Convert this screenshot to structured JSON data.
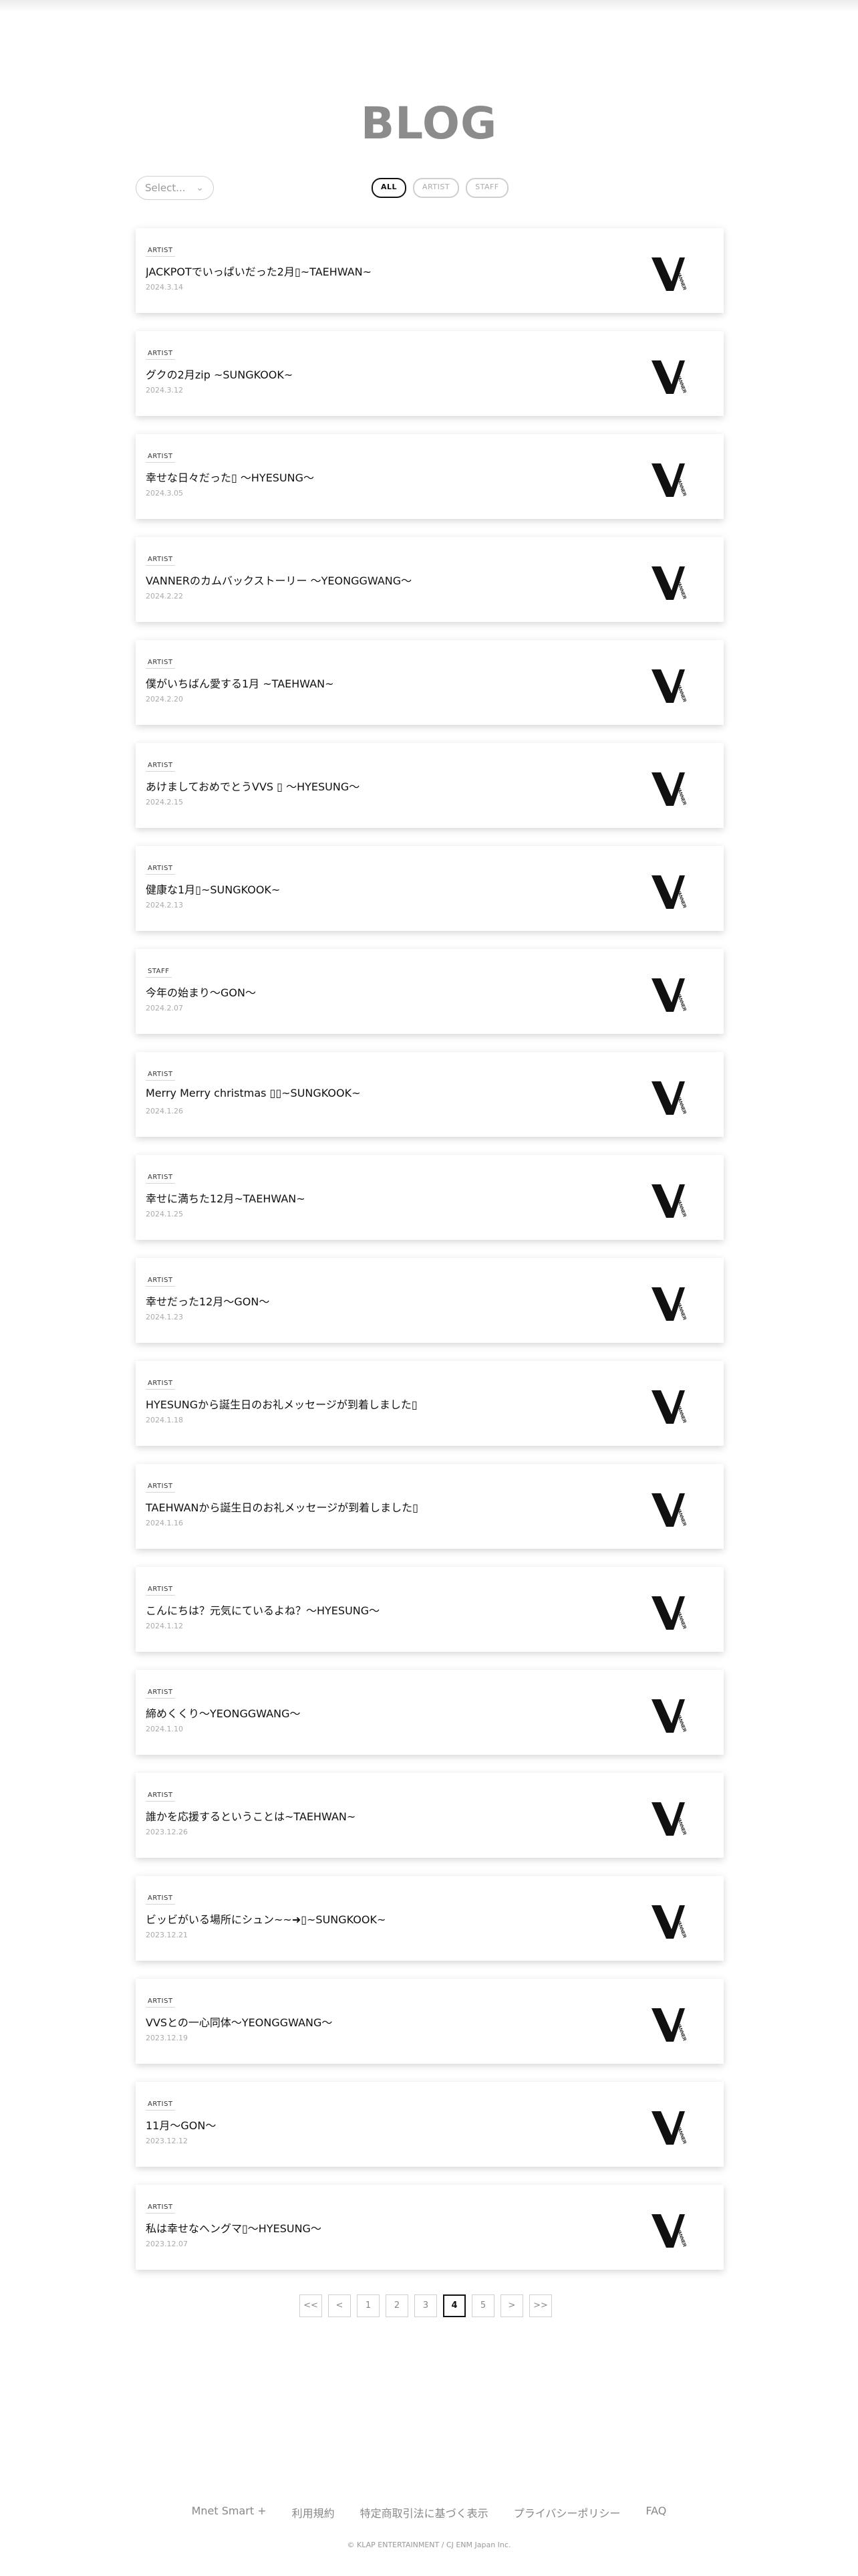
{
  "page": {
    "title": "BLOG"
  },
  "select": {
    "placeholder": "Select..."
  },
  "filters": [
    {
      "label": "ALL",
      "active": true
    },
    {
      "label": "ARTIST",
      "active": false
    },
    {
      "label": "STAFF",
      "active": false
    }
  ],
  "posts": [
    {
      "category": "ARTIST",
      "title": "JACKPOTでいっぱいだった2月▯~TAEHWAN~",
      "date": "2024.3.14"
    },
    {
      "category": "ARTIST",
      "title": "グクの2月zip ~SUNGKOOK~",
      "date": "2024.3.12"
    },
    {
      "category": "ARTIST",
      "title": "幸せな日々だった▯ 〜HYESUNG〜",
      "date": "2024.3.05"
    },
    {
      "category": "ARTIST",
      "title": "VANNERのカムバックストーリー 〜YEONGGWANG〜",
      "date": "2024.2.22"
    },
    {
      "category": "ARTIST",
      "title": "僕がいちばん愛する1月 ~TAEHWAN~",
      "date": "2024.2.20"
    },
    {
      "category": "ARTIST",
      "title": "あけましておめでとうVVS ▯ 〜HYESUNG〜",
      "date": "2024.2.15"
    },
    {
      "category": "ARTIST",
      "title": "健康な1月▯~SUNGKOOK~",
      "date": "2024.2.13"
    },
    {
      "category": "STAFF",
      "title": "今年の始まり〜GON〜",
      "date": "2024.2.07"
    },
    {
      "category": "ARTIST",
      "title": "Merry Merry christmas ▯▯~SUNGKOOK~",
      "date": "2024.1.26"
    },
    {
      "category": "ARTIST",
      "title": "幸せに満ちた12月~TAEHWAN~",
      "date": "2024.1.25"
    },
    {
      "category": "ARTIST",
      "title": "幸せだった12月〜GON〜",
      "date": "2024.1.23"
    },
    {
      "category": "ARTIST",
      "title": "HYESUNGから誕生日のお礼メッセージが到着しました▯",
      "date": "2024.1.18"
    },
    {
      "category": "ARTIST",
      "title": "TAEHWANから誕生日のお礼メッセージが到着しました▯",
      "date": "2024.1.16"
    },
    {
      "category": "ARTIST",
      "title": "こんにちは？元気にているよね？〜HYESUNG〜",
      "date": "2024.1.12"
    },
    {
      "category": "ARTIST",
      "title": "締めくくり〜YEONGGWANG〜",
      "date": "2024.1.10"
    },
    {
      "category": "ARTIST",
      "title": "誰かを応援するということは~TAEHWAN~",
      "date": "2023.12.26"
    },
    {
      "category": "ARTIST",
      "title": "ビッビがいる場所にシュン~~➜▯~SUNGKOOK~",
      "date": "2023.12.21"
    },
    {
      "category": "ARTIST",
      "title": "VVSとの一心同体〜YEONGGWANG〜",
      "date": "2023.12.19"
    },
    {
      "category": "ARTIST",
      "title": "11月〜GON〜",
      "date": "2023.12.12"
    },
    {
      "category": "ARTIST",
      "title": "私は幸せなヘングマ▯〜HYESUNG〜",
      "date": "2023.12.07"
    }
  ],
  "logo": {
    "text": "VANNER"
  },
  "pagination": {
    "first": "<<",
    "prev": "<",
    "pages": [
      "1",
      "2",
      "3",
      "4",
      "5"
    ],
    "current": "4",
    "next": ">",
    "last": ">>"
  },
  "footer": {
    "links": [
      "Mnet Smart +",
      "利用規約",
      "特定商取引法に基づく表示",
      "プライバシーポリシー",
      "FAQ"
    ],
    "copyright": "© KLAP ENTERTAINMENT / CJ ENM Japan Inc."
  },
  "colors": {
    "title_gray": "#8c8c8c",
    "active_filter": "#111111",
    "border_gray": "#cfcfcf"
  }
}
